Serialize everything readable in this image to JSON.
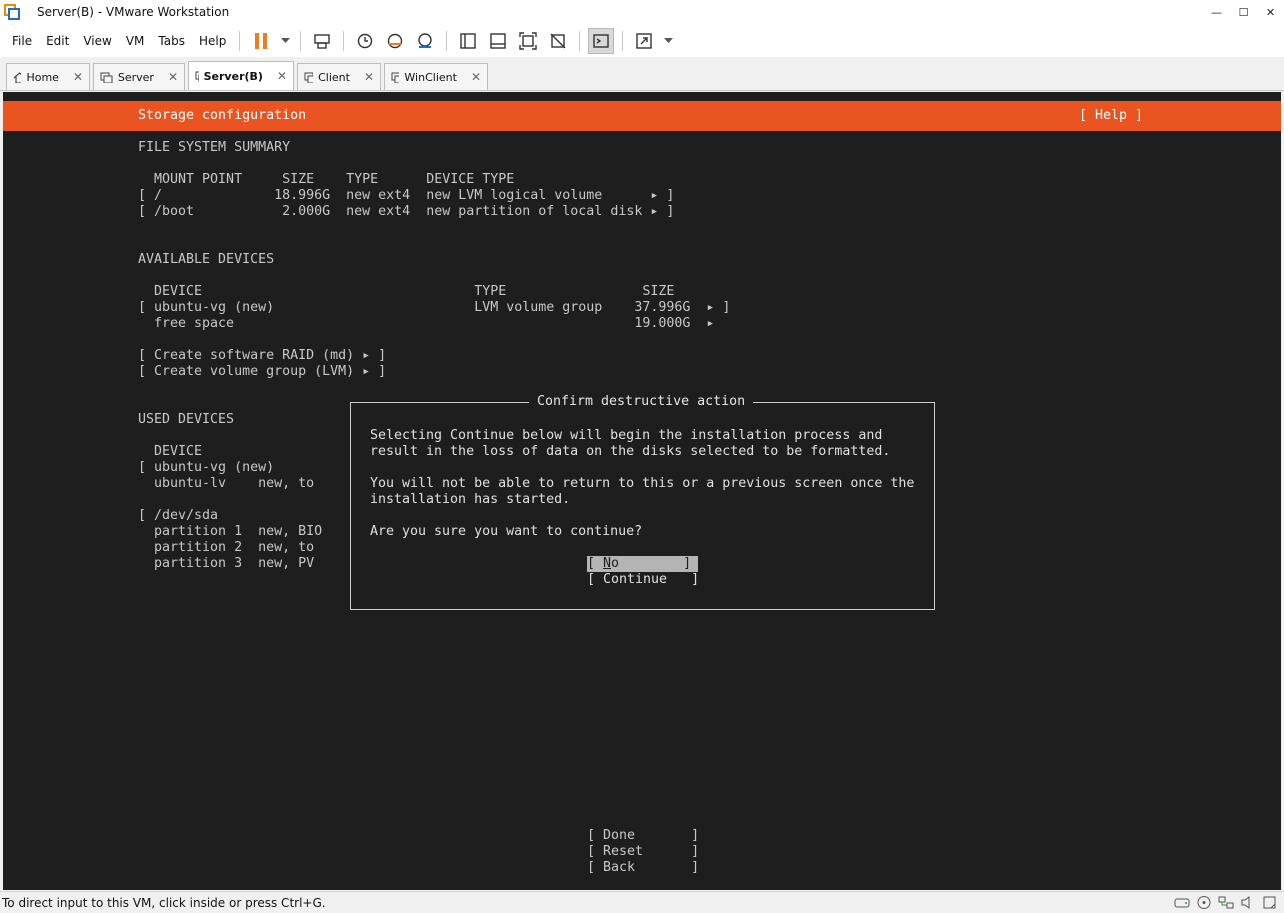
{
  "window": {
    "title": "Server(B) - VMware Workstation",
    "minimize": "—",
    "maximize": "☐",
    "close": "✕"
  },
  "menu": {
    "items": [
      "File",
      "Edit",
      "View",
      "VM",
      "Tabs",
      "Help"
    ]
  },
  "tabs": [
    {
      "label": "Home"
    },
    {
      "label": "Server"
    },
    {
      "label": "Server(B)"
    },
    {
      "label": "Client"
    },
    {
      "label": "WinClient"
    }
  ],
  "vm": {
    "header_title": "Storage configuration",
    "header_help": "[ Help ]",
    "fs_summary": {
      "heading": "FILE SYSTEM SUMMARY",
      "columns": "  MOUNT POINT     SIZE    TYPE      DEVICE TYPE",
      "rows": [
        "[ /              18.996G  new ext4  new LVM logical volume      ▸ ]",
        "[ /boot           2.000G  new ext4  new partition of local disk ▸ ]"
      ]
    },
    "available": {
      "heading": "AVAILABLE DEVICES",
      "columns": "  DEVICE                                  TYPE                 SIZE",
      "rows": [
        "[ ubuntu-vg (new)                         LVM volume group    37.996G  ▸ ]",
        "  free space                                                  19.000G  ▸"
      ],
      "actions": [
        "[ Create software RAID (md) ▸ ]",
        "[ Create volume group (LVM) ▸ ]"
      ]
    },
    "used": {
      "heading": "USED DEVICES",
      "columns": "  DEVICE",
      "rows": [
        "[ ubuntu-vg (new)",
        "  ubuntu-lv    new, to",
        "",
        "[ /dev/sda",
        "  partition 1  new, BIO",
        "  partition 2  new, to",
        "  partition 3  new, PV"
      ]
    },
    "dialog": {
      "title": "Confirm destructive action",
      "lines": [
        "Selecting Continue below will begin the installation process and",
        "result in the loss of data on the disks selected to be formatted.",
        "",
        "You will not be able to return to this or a previous screen once the",
        "installation has started.",
        "",
        "Are you sure you want to continue?"
      ],
      "no_prefix": "[ ",
      "no_accel": "N",
      "no_rest": "o",
      "no_suffix": "        ]",
      "continue_label": "[ Continue   ]"
    },
    "bottom_buttons": [
      "[ Done       ]",
      "[ Reset      ]",
      "[ Back       ]"
    ]
  },
  "status": {
    "text": "To direct input to this VM, click inside or press Ctrl+G."
  },
  "colors": {
    "ubuntu_orange": "#e95420",
    "pause_orange": "#f07a1e"
  }
}
